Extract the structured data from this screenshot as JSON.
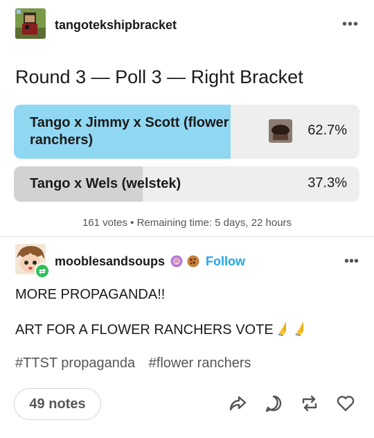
{
  "post": {
    "blog_name": "tangotekshipbracket",
    "more_label": "•••"
  },
  "poll": {
    "title": "Round 3 — Poll 3 — Right Bracket",
    "options": [
      {
        "label": "Tango x Jimmy x Scott (flower ranchers)",
        "percent_label": "62.7%",
        "percent": 62.7
      },
      {
        "label": "Tango x Wels (welstek)",
        "percent_label": "37.3%",
        "percent": 37.3
      }
    ],
    "meta": "161 votes • Remaining time: 5 days, 22 hours"
  },
  "reblog": {
    "blog_name": "mooblesandsoups",
    "follow_label": "Follow",
    "more_label": "•••",
    "lines": [
      "MORE PROPAGANDA!!",
      "ART FOR A FLOWER RANCHERS VOTE"
    ],
    "tags": [
      "#TTST propaganda",
      "#flower ranchers"
    ]
  },
  "footer": {
    "notes_label": "49 notes",
    "icons": [
      "share-icon",
      "reply-icon",
      "reblog-icon",
      "like-icon"
    ]
  },
  "colors": {
    "winner_fill": "#90d7f2",
    "loser_fill": "#d2d2d2",
    "option_bg": "#eeeeee",
    "follow_blue": "#1fa7e6",
    "reblog_green": "#2ec15a"
  }
}
